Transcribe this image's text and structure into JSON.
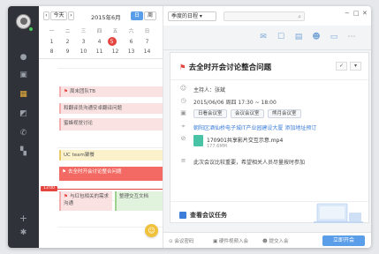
{
  "calendar": {
    "today_btn": "今天",
    "month": "2015年6月",
    "view_day": "日",
    "view_week": "周",
    "weekdays": [
      "一",
      "二",
      "三",
      "四",
      "五",
      "六",
      "日"
    ],
    "dates_row1": [
      "1",
      "2",
      "3",
      "4",
      "5",
      "6",
      "7"
    ],
    "dates_row2": [
      "8",
      "9",
      "10",
      "11",
      "12",
      "13",
      "14"
    ],
    "now_time": "13:00",
    "events": [
      {
        "label": "周末团队TB"
      },
      {
        "label": "和翻译员沟通安卓翻译问题"
      },
      {
        "label": "蜜蜂视觉讨论"
      },
      {
        "label": "UC team聚餐"
      },
      {
        "label": "去全时开会讨论整合问题"
      },
      {
        "label": "与红包相关的需求沟通"
      },
      {
        "label": "整理交互文档"
      }
    ]
  },
  "toolbar": {
    "view_select": "季度的日程",
    "search_placeholder": ""
  },
  "detail": {
    "title": "去全时开会讨论整合问题",
    "confirm": "✓",
    "more": "▾",
    "host": "主持人：张斌",
    "datetime": "2015/06/06  周四  17:30 ~ 18:00",
    "rooms": [
      "日看会议室",
      "会议会议室",
      "熊月会议室"
    ],
    "address": "朝阳区酒仙桥电子城IT产业园建设大厦",
    "add_address": "添加地址预订",
    "file_name": "170901共享影片交互示意.mp4",
    "file_size": "177.6MM",
    "note": "此次会议比较重要，希望相关人员尽量按时参加",
    "task": "查看会议任务"
  },
  "bottombar": {
    "password": "会议密码",
    "join_phone": "硬件视频入会",
    "share": "提交入会",
    "join_btn": "立即开会"
  }
}
